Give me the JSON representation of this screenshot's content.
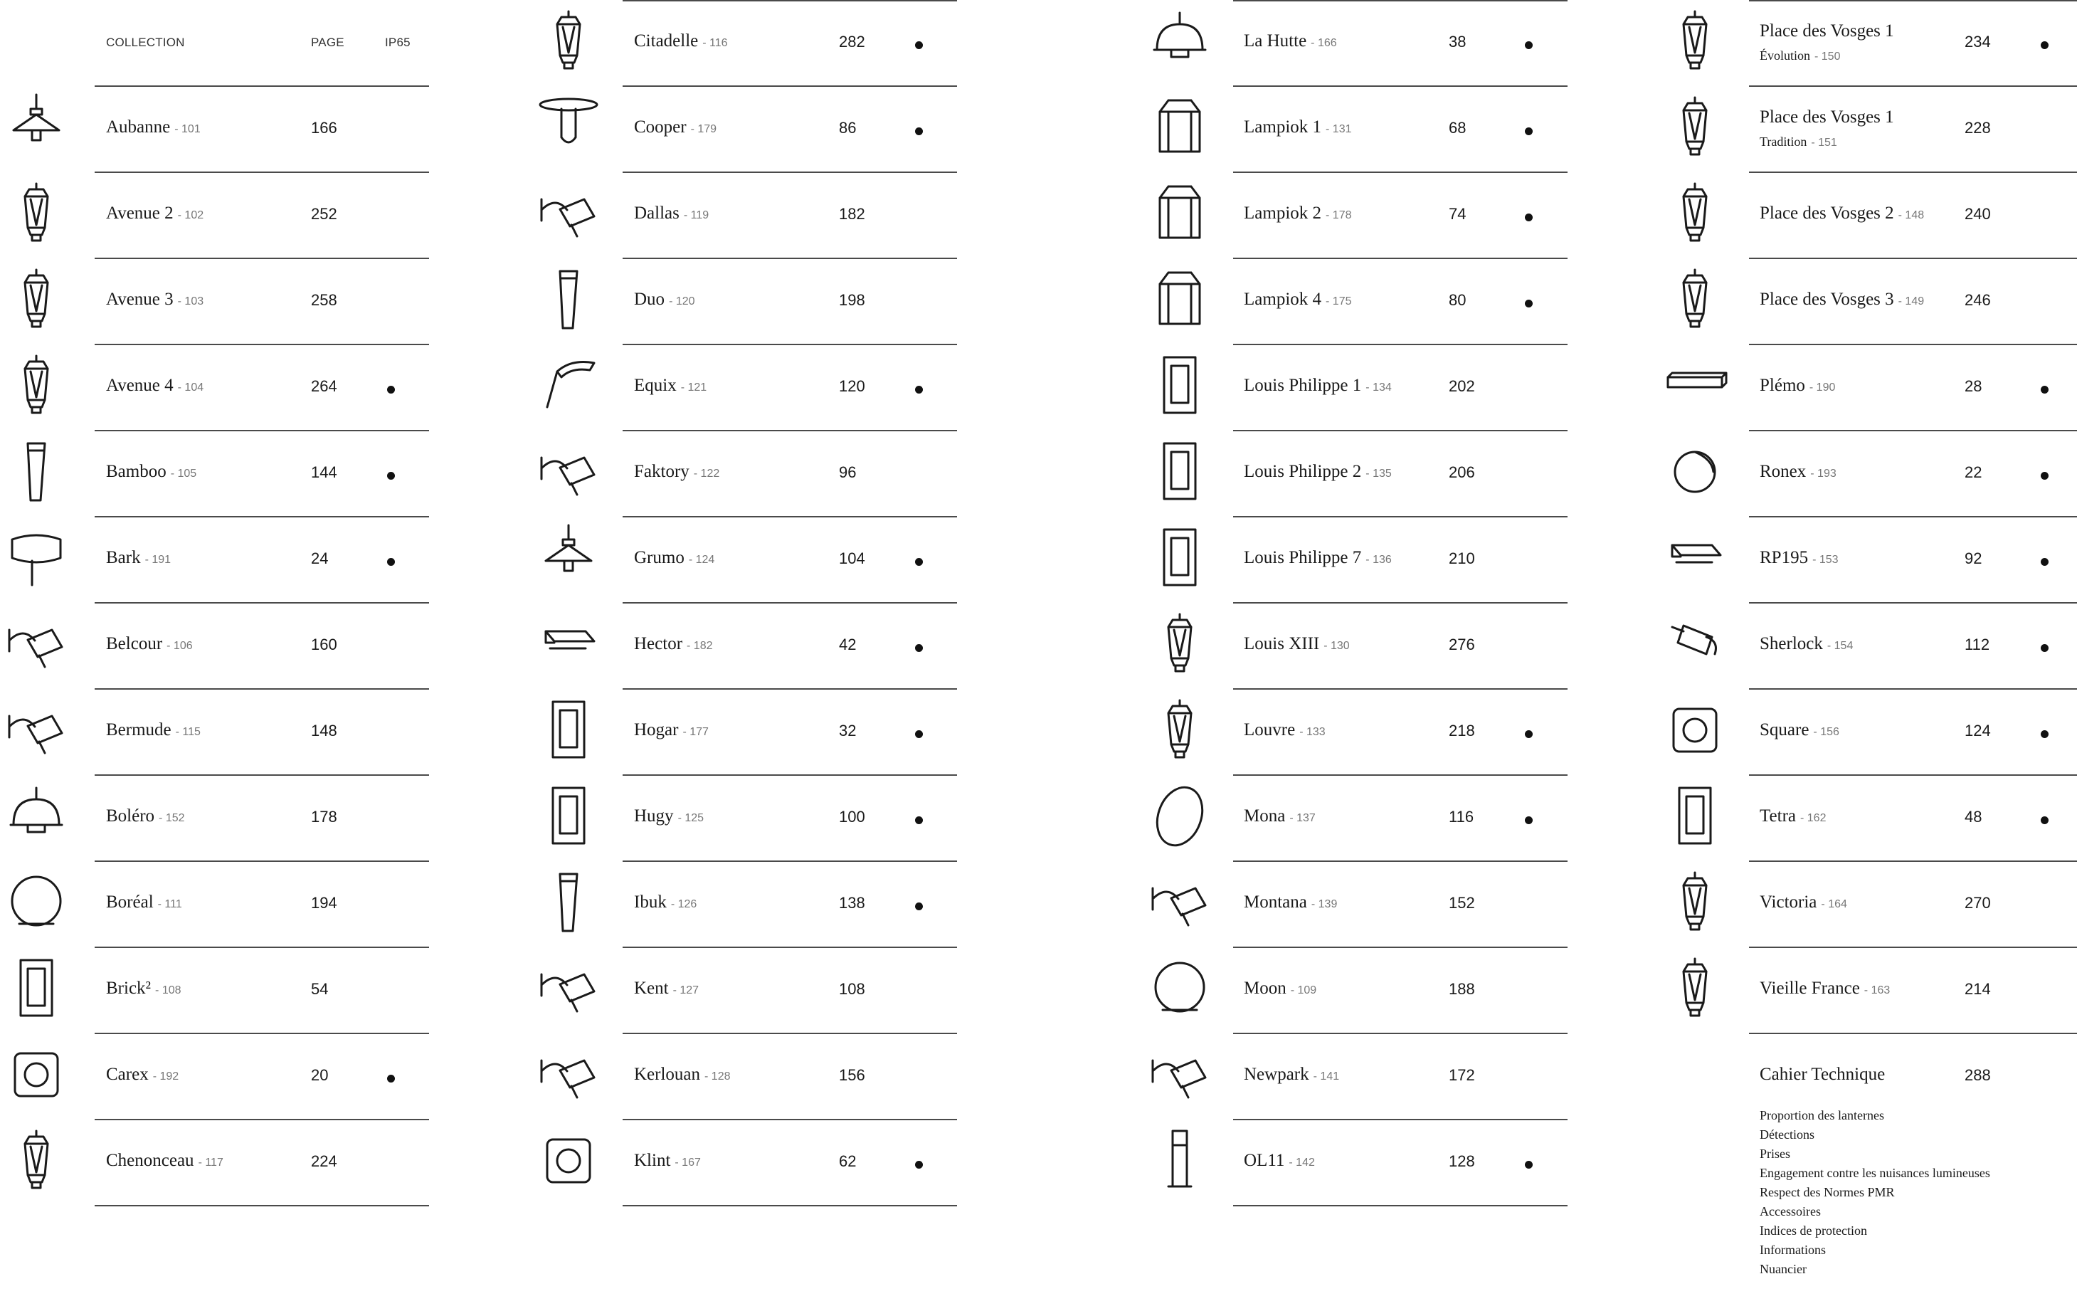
{
  "headers": {
    "collection": "COLLECTION",
    "page": "PAGE",
    "ip65": "IP65"
  },
  "columns": [
    [
      {
        "name": "Aubanne",
        "ref": "- 101",
        "page": "166",
        "ip65": false,
        "icon": "pendant-lamp-icon"
      },
      {
        "name": "Avenue 2",
        "ref": "- 102",
        "page": "252",
        "ip65": false,
        "icon": "lantern-icon"
      },
      {
        "name": "Avenue 3",
        "ref": "- 103",
        "page": "258",
        "ip65": false,
        "icon": "lantern-icon"
      },
      {
        "name": "Avenue 4",
        "ref": "- 104",
        "page": "264",
        "ip65": true,
        "icon": "lantern-icon"
      },
      {
        "name": "Bamboo",
        "ref": "- 105",
        "page": "144",
        "ip65": true,
        "icon": "tube-light-icon"
      },
      {
        "name": "Bark",
        "ref": "- 191",
        "page": "24",
        "ip65": true,
        "icon": "drum-light-icon"
      },
      {
        "name": "Belcour",
        "ref": "- 106",
        "page": "160",
        "ip65": false,
        "icon": "wall-arm-lamp-icon"
      },
      {
        "name": "Bermude",
        "ref": "- 115",
        "page": "148",
        "ip65": false,
        "icon": "wall-arm-lamp-icon"
      },
      {
        "name": "Boléro",
        "ref": "- 152",
        "page": "178",
        "ip65": false,
        "icon": "dome-lamp-icon"
      },
      {
        "name": "Boréal",
        "ref": "- 111",
        "page": "194",
        "ip65": false,
        "icon": "globe-lamp-icon"
      },
      {
        "name": "Brick²",
        "ref": "- 108",
        "page": "54",
        "ip65": false,
        "icon": "box-light-icon"
      },
      {
        "name": "Carex",
        "ref": "- 192",
        "page": "20",
        "ip65": true,
        "icon": "square-wall-light-icon"
      },
      {
        "name": "Chenonceau",
        "ref": "- 117",
        "page": "224",
        "ip65": false,
        "icon": "lantern-icon"
      }
    ],
    [
      {
        "name": "Citadelle",
        "ref": "- 116",
        "page": "282",
        "ip65": true,
        "icon": "lantern-icon"
      },
      {
        "name": "Cooper",
        "ref": "- 179",
        "page": "86",
        "ip65": true,
        "icon": "ceiling-lamp-icon"
      },
      {
        "name": "Dallas",
        "ref": "- 119",
        "page": "182",
        "ip65": false,
        "icon": "wall-arm-lamp-icon"
      },
      {
        "name": "Duo",
        "ref": "- 120",
        "page": "198",
        "ip65": false,
        "icon": "tube-light-icon"
      },
      {
        "name": "Equix",
        "ref": "- 121",
        "page": "120",
        "ip65": true,
        "icon": "street-light-icon"
      },
      {
        "name": "Faktory",
        "ref": "- 122",
        "page": "96",
        "ip65": false,
        "icon": "wall-arm-lamp-icon"
      },
      {
        "name": "Grumo",
        "ref": "- 124",
        "page": "104",
        "ip65": true,
        "icon": "pendant-lamp-icon"
      },
      {
        "name": "Hector",
        "ref": "- 182",
        "page": "42",
        "ip65": true,
        "icon": "flood-light-icon"
      },
      {
        "name": "Hogar",
        "ref": "- 177",
        "page": "32",
        "ip65": true,
        "icon": "box-light-icon"
      },
      {
        "name": "Hugy",
        "ref": "- 125",
        "page": "100",
        "ip65": true,
        "icon": "box-light-icon"
      },
      {
        "name": "Ibuk",
        "ref": "- 126",
        "page": "138",
        "ip65": true,
        "icon": "tube-light-icon"
      },
      {
        "name": "Kent",
        "ref": "- 127",
        "page": "108",
        "ip65": false,
        "icon": "wall-arm-lamp-icon"
      },
      {
        "name": "Kerlouan",
        "ref": "- 128",
        "page": "156",
        "ip65": false,
        "icon": "wall-arm-lamp-icon"
      },
      {
        "name": "Klint",
        "ref": "- 167",
        "page": "62",
        "ip65": true,
        "icon": "square-wall-light-icon"
      }
    ],
    [
      {
        "name": "La Hutte",
        "ref": "- 166",
        "page": "38",
        "ip65": true,
        "icon": "dome-lamp-icon"
      },
      {
        "name": "Lampiok 1",
        "ref": "- 131",
        "page": "68",
        "ip65": true,
        "icon": "cage-lantern-icon"
      },
      {
        "name": "Lampiok 2",
        "ref": "- 178",
        "page": "74",
        "ip65": true,
        "icon": "cage-lantern-icon"
      },
      {
        "name": "Lampiok 4",
        "ref": "- 175",
        "page": "80",
        "ip65": true,
        "icon": "cage-lantern-icon"
      },
      {
        "name": "Louis Philippe 1",
        "ref": "- 134",
        "page": "202",
        "ip65": false,
        "icon": "box-light-icon"
      },
      {
        "name": "Louis Philippe 2",
        "ref": "- 135",
        "page": "206",
        "ip65": false,
        "icon": "box-light-icon"
      },
      {
        "name": "Louis Philippe 7",
        "ref": "- 136",
        "page": "210",
        "ip65": false,
        "icon": "box-light-icon"
      },
      {
        "name": "Louis XIII",
        "ref": "- 130",
        "page": "276",
        "ip65": false,
        "icon": "lantern-icon"
      },
      {
        "name": "Louvre",
        "ref": "- 133",
        "page": "218",
        "ip65": true,
        "icon": "lantern-icon"
      },
      {
        "name": "Mona",
        "ref": "- 137",
        "page": "116",
        "ip65": true,
        "icon": "oval-light-icon"
      },
      {
        "name": "Montana",
        "ref": "- 139",
        "page": "152",
        "ip65": false,
        "icon": "wall-arm-lamp-icon"
      },
      {
        "name": "Moon",
        "ref": "- 109",
        "page": "188",
        "ip65": false,
        "icon": "globe-lamp-icon"
      },
      {
        "name": "Newpark",
        "ref": "- 141",
        "page": "172",
        "ip65": false,
        "icon": "wall-arm-lamp-icon"
      },
      {
        "name": "OL11",
        "ref": "- 142",
        "page": "128",
        "ip65": true,
        "icon": "bollard-light-icon"
      }
    ],
    [
      {
        "name": "Place des Vosges 1",
        "sub": "Évolution",
        "ref": "- 150",
        "page": "234",
        "ip65": true,
        "icon": "lantern-icon"
      },
      {
        "name": "Place des Vosges 1",
        "sub": "Tradition",
        "ref": "- 151",
        "page": "228",
        "ip65": false,
        "icon": "lantern-icon"
      },
      {
        "name": "Place des Vosges 2",
        "ref": "- 148",
        "page": "240",
        "ip65": false,
        "icon": "lantern-icon"
      },
      {
        "name": "Place des Vosges 3",
        "ref": "- 149",
        "page": "246",
        "ip65": false,
        "icon": "lantern-icon"
      },
      {
        "name": "Plémo",
        "ref": "- 190",
        "page": "28",
        "ip65": true,
        "icon": "linear-light-icon"
      },
      {
        "name": "Ronex",
        "ref": "- 193",
        "page": "22",
        "ip65": true,
        "icon": "round-wall-light-icon"
      },
      {
        "name": "RP195",
        "ref": "- 153",
        "page": "92",
        "ip65": true,
        "icon": "flood-light-icon"
      },
      {
        "name": "Sherlock",
        "ref": "- 154",
        "page": "112",
        "ip65": true,
        "icon": "spot-light-icon"
      },
      {
        "name": "Square",
        "ref": "- 156",
        "page": "124",
        "ip65": true,
        "icon": "square-wall-light-icon"
      },
      {
        "name": "Tetra",
        "ref": "- 162",
        "page": "48",
        "ip65": true,
        "icon": "box-light-icon"
      },
      {
        "name": "Victoria",
        "ref": "- 164",
        "page": "270",
        "ip65": false,
        "icon": "lantern-icon"
      },
      {
        "name": "Vieille France",
        "ref": "- 163",
        "page": "214",
        "ip65": false,
        "icon": "lantern-icon"
      }
    ]
  ],
  "technical": {
    "title": "Cahier Technique",
    "page": "288",
    "items": [
      "Proportion des lanternes",
      "Détections",
      "Prises",
      "Engagement contre les nuisances lumineuses",
      "Respect des Normes PMR",
      "Accessoires",
      "Indices de protection",
      "Informations",
      "Nuancier"
    ]
  }
}
